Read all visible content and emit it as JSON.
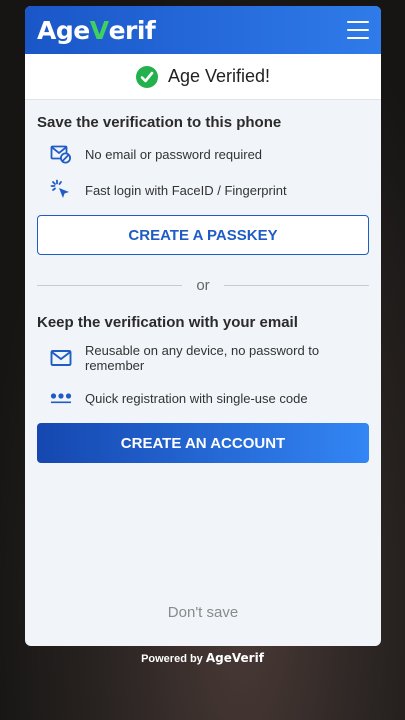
{
  "brand": {
    "logo_prefix": "Age",
    "logo_v": "V",
    "logo_suffix": "erif",
    "accent": "#1f5cc5",
    "check_color": "#22b14c"
  },
  "header": {
    "menu_icon": "hamburger-icon"
  },
  "status": {
    "text": "Age Verified!",
    "icon": "check-circle-icon"
  },
  "phone_section": {
    "title": "Save the verification to this phone",
    "features": [
      {
        "icon": "no-email-icon",
        "text": "No email or password required"
      },
      {
        "icon": "tap-icon",
        "text": "Fast login with FaceID / Fingerprint"
      }
    ],
    "button_label": "CREATE A PASSKEY"
  },
  "divider_label": "or",
  "email_section": {
    "title": "Keep the verification with your email",
    "features": [
      {
        "icon": "envelope-icon",
        "text": "Reusable on any device, no password to remember"
      },
      {
        "icon": "code-dots-icon",
        "text": "Quick registration with single-use code"
      }
    ],
    "button_label": "CREATE AN ACCOUNT"
  },
  "dont_save_label": "Don't save",
  "footer": {
    "powered_label": "Powered by",
    "brand_prefix": "A",
    "brand_suffix": "geVerif"
  }
}
